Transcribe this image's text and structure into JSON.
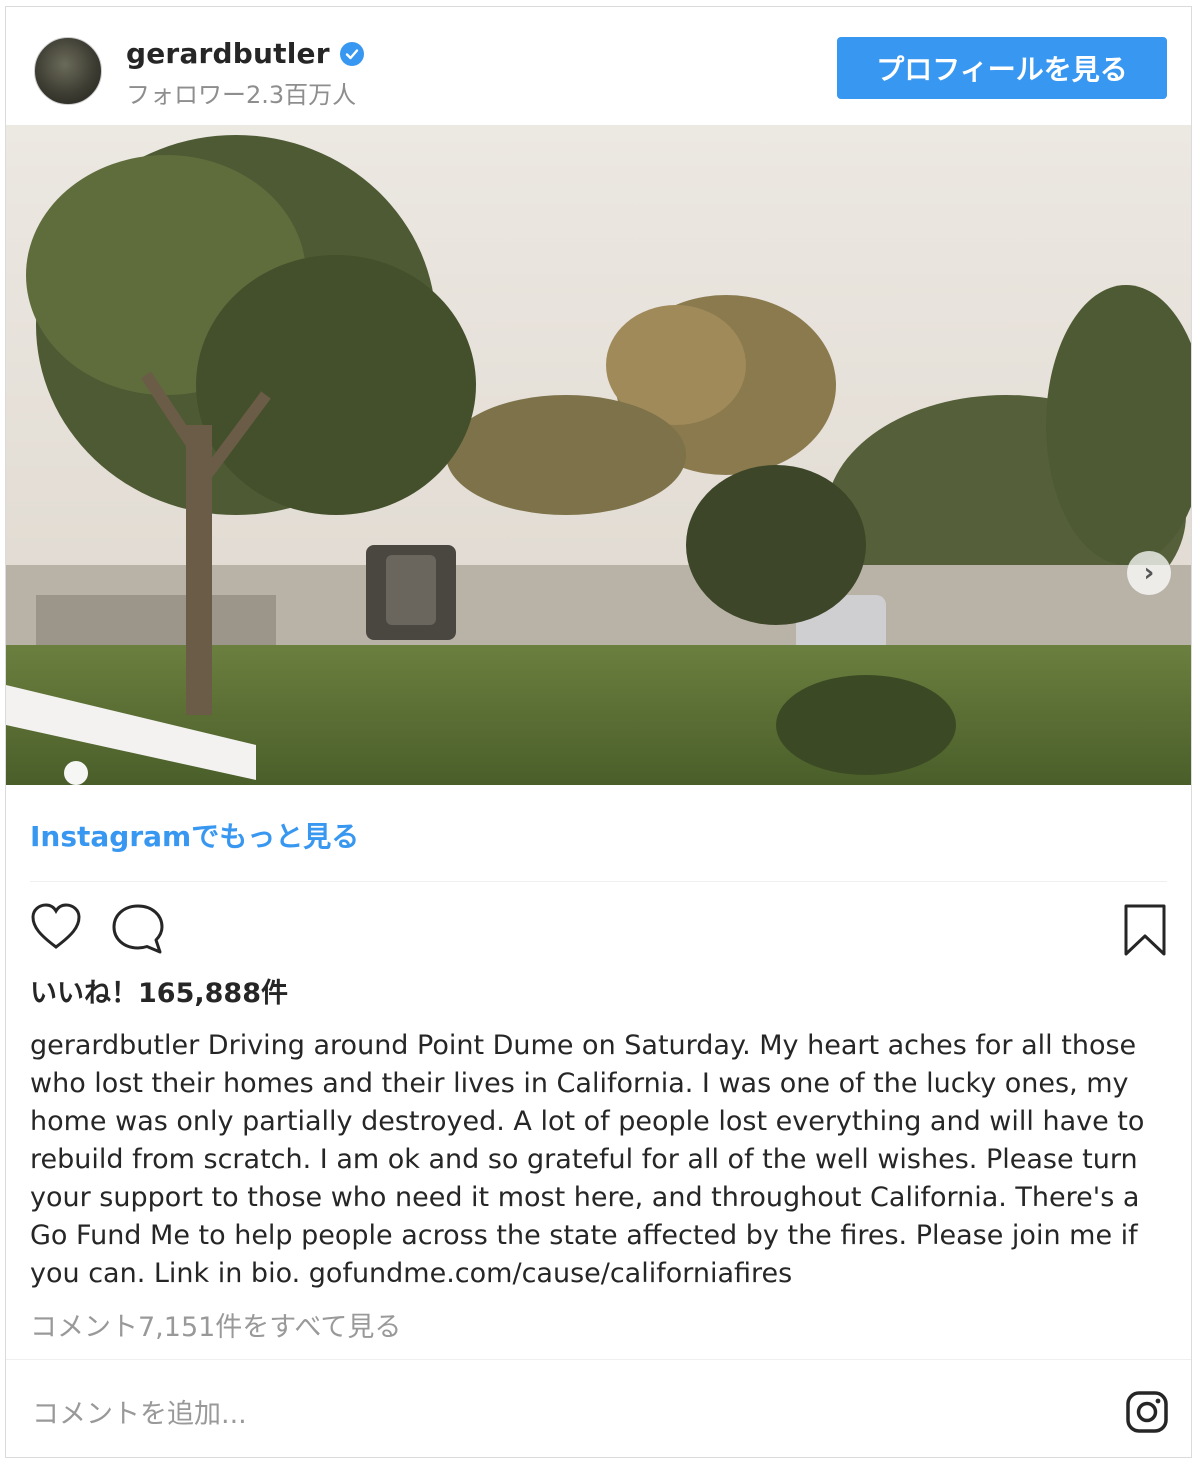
{
  "header": {
    "username": "gerardbutler",
    "followers": "フォロワー2.3百万人",
    "profile_button": "プロフィールを見る"
  },
  "post": {
    "more_link": "Instagramでもっと見る",
    "likes": "いいね！165,888件",
    "caption_user": "gerardbutler",
    "caption_text": " Driving around Point Dume on Saturday. My heart aches for all those who lost their homes and their lives in California. I was one of the lucky ones, my home was only partially destroyed. A lot of people lost everything and will have to rebuild from scratch. I am ok and so grateful for all of the well wishes. Please turn your support to those who need it most here, and throughout California. There's a Go Fund Me to help people across the state affected by the fires. Please join me if you can. Link in bio. gofundme.com/cause/californiafires",
    "view_comments": "コメント7,151件をすべて見る",
    "comment_placeholder": "コメントを追加..."
  },
  "icons": {
    "verified": "verified-badge-icon",
    "next": "chevron-right-icon",
    "like": "heart-icon",
    "comment": "comment-bubble-icon",
    "save": "bookmark-icon",
    "brand": "instagram-icon"
  },
  "colors": {
    "accent": "#3897f0",
    "muted": "#8e8e8e"
  }
}
